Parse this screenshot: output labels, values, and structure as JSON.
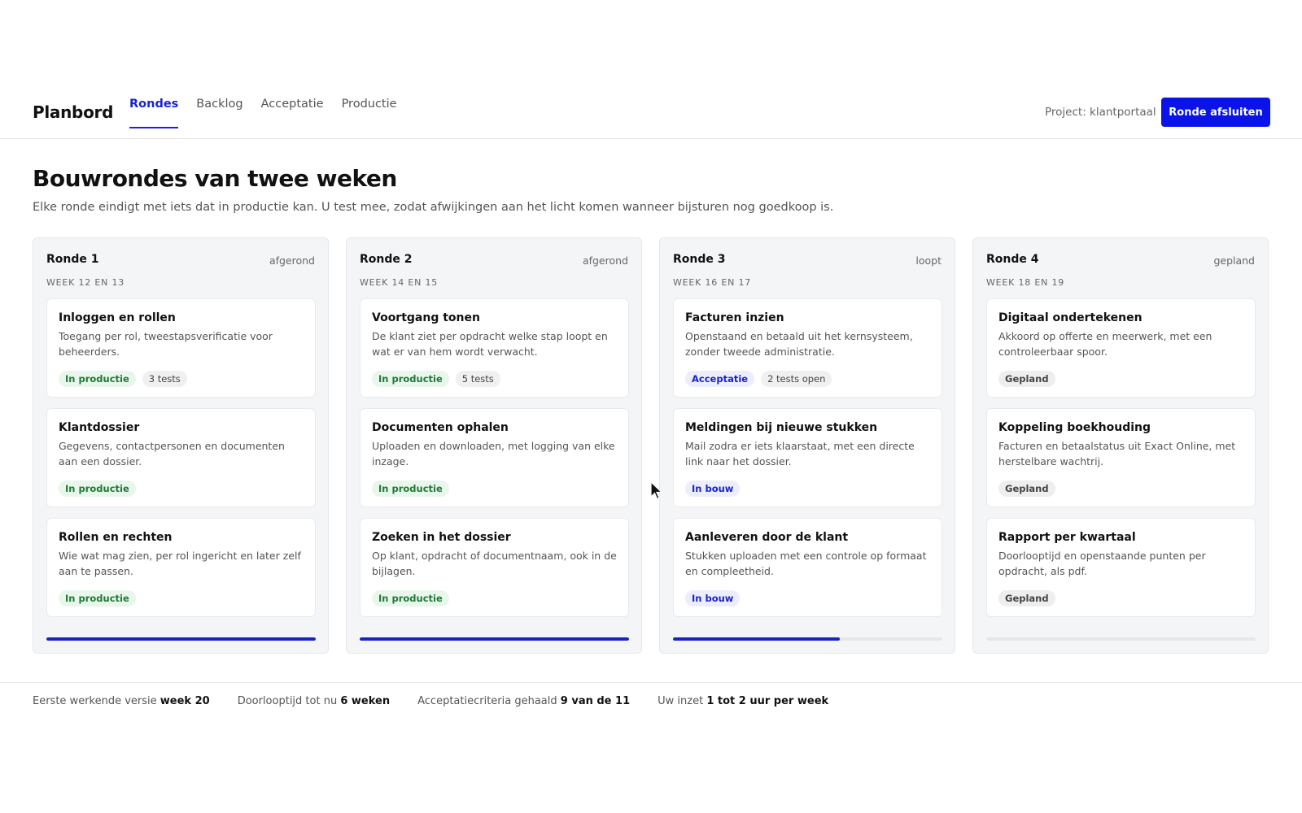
{
  "header": {
    "brand": "Planbord",
    "tabs": [
      {
        "label": "Rondes",
        "active": true
      },
      {
        "label": "Backlog",
        "active": false
      },
      {
        "label": "Acceptatie",
        "active": false
      },
      {
        "label": "Productie",
        "active": false
      }
    ],
    "project": "Project: klantportaal",
    "primary_button": "Ronde afsluiten"
  },
  "page": {
    "title": "Bouwrondes van twee weken",
    "subtitle": "Elke ronde eindigt met iets dat in productie kan. U test mee, zodat afwijkingen aan het licht komen wanneer bijsturen nog goedkoop is."
  },
  "rounds": [
    {
      "title": "Ronde 1",
      "status": "afgerond",
      "weeks": "WEEK 12 EN 13",
      "progress": 1.0,
      "cards": [
        {
          "title": "Inloggen en rollen",
          "desc": "Toegang per rol, tweestapsverificatie voor beheerders.",
          "tags": [
            {
              "label": "In productie",
              "kind": "green"
            },
            {
              "label": "3 tests",
              "kind": "plain"
            }
          ]
        },
        {
          "title": "Klantdossier",
          "desc": "Gegevens, contactpersonen en documenten aan een dossier.",
          "tags": [
            {
              "label": "In productie",
              "kind": "green"
            }
          ]
        },
        {
          "title": "Rollen en rechten",
          "desc": "Wie wat mag zien, per rol ingericht en later zelf aan te passen.",
          "tags": [
            {
              "label": "In productie",
              "kind": "green"
            }
          ]
        }
      ]
    },
    {
      "title": "Ronde 2",
      "status": "afgerond",
      "weeks": "WEEK 14 EN 15",
      "progress": 1.0,
      "cards": [
        {
          "title": "Voortgang tonen",
          "desc": "De klant ziet per opdracht welke stap loopt en wat er van hem wordt verwacht.",
          "tags": [
            {
              "label": "In productie",
              "kind": "green"
            },
            {
              "label": "5 tests",
              "kind": "plain"
            }
          ]
        },
        {
          "title": "Documenten ophalen",
          "desc": "Uploaden en downloaden, met logging van elke inzage.",
          "tags": [
            {
              "label": "In productie",
              "kind": "green"
            }
          ]
        },
        {
          "title": "Zoeken in het dossier",
          "desc": "Op klant, opdracht of documentnaam, ook in de bijlagen.",
          "tags": [
            {
              "label": "In productie",
              "kind": "green"
            }
          ]
        }
      ]
    },
    {
      "title": "Ronde 3",
      "status": "loopt",
      "weeks": "WEEK 16 EN 17",
      "progress": 0.62,
      "cards": [
        {
          "title": "Facturen inzien",
          "desc": "Openstaand en betaald uit het kernsysteem, zonder tweede administratie.",
          "tags": [
            {
              "label": "Acceptatie",
              "kind": "blue"
            },
            {
              "label": "2 tests open",
              "kind": "plain"
            }
          ]
        },
        {
          "title": "Meldingen bij nieuwe stukken",
          "desc": "Mail zodra er iets klaarstaat, met een directe link naar het dossier.",
          "tags": [
            {
              "label": "In bouw",
              "kind": "blue"
            }
          ]
        },
        {
          "title": "Aanleveren door de klant",
          "desc": "Stukken uploaden met een controle op formaat en compleetheid.",
          "tags": [
            {
              "label": "In bouw",
              "kind": "blue"
            }
          ]
        }
      ]
    },
    {
      "title": "Ronde 4",
      "status": "gepland",
      "weeks": "WEEK 18 EN 19",
      "progress": 0.0,
      "cards": [
        {
          "title": "Digitaal ondertekenen",
          "desc": "Akkoord op offerte en meerwerk, met een controleerbaar spoor.",
          "tags": [
            {
              "label": "Gepland",
              "kind": "grey"
            }
          ]
        },
        {
          "title": "Koppeling boekhouding",
          "desc": "Facturen en betaalstatus uit Exact Online, met herstelbare wachtrij.",
          "tags": [
            {
              "label": "Gepland",
              "kind": "grey"
            }
          ]
        },
        {
          "title": "Rapport per kwartaal",
          "desc": "Doorlooptijd en openstaande punten per opdracht, als pdf.",
          "tags": [
            {
              "label": "Gepland",
              "kind": "grey"
            }
          ]
        }
      ]
    }
  ],
  "footer": {
    "stats": [
      {
        "label": "Eerste werkende versie",
        "value": "week 20"
      },
      {
        "label": "Doorlooptijd tot nu",
        "value": "6 weken"
      },
      {
        "label": "Acceptatiecriteria gehaald",
        "value": "9 van de 11"
      },
      {
        "label": "Uw inzet",
        "value": "1 tot 2 uur per week"
      }
    ]
  },
  "colors": {
    "accent": "#0a14e8",
    "success": "#1d7a35",
    "info": "#1a23c8"
  }
}
